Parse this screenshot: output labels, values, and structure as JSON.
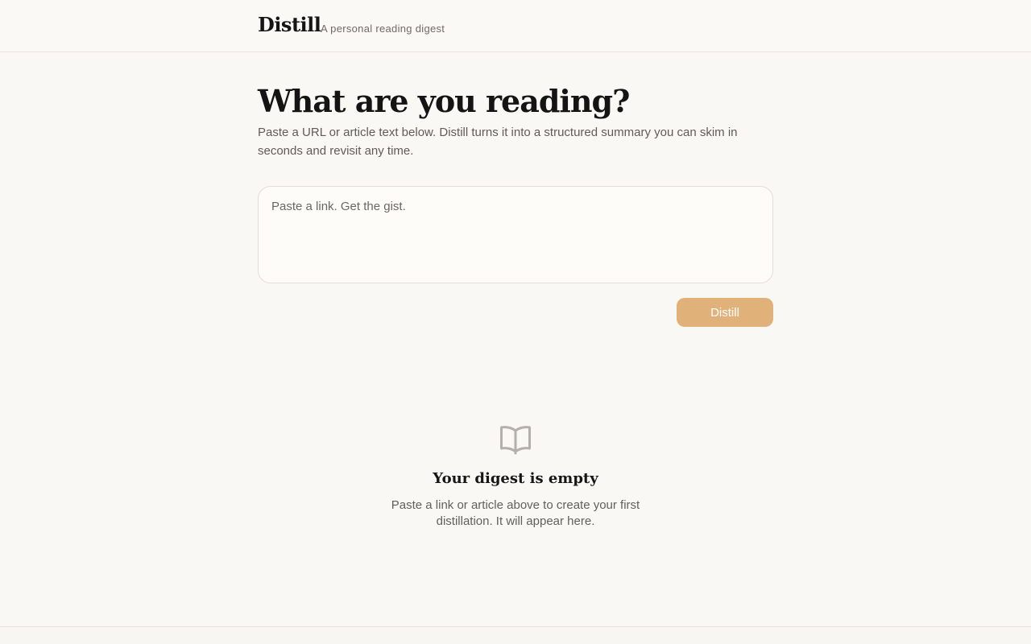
{
  "header": {
    "brand": "Distill",
    "tagline": "A personal reading digest"
  },
  "main": {
    "headline": "What are you reading?",
    "intro": "Paste a URL or article text below. Distill turns it into a structured summary you can skim in seconds and revisit any time.",
    "input": {
      "placeholder": "Paste a link. Get the gist.",
      "value": ""
    },
    "submit_label": "Distill"
  },
  "empty_state": {
    "icon": "open-book-icon",
    "title": "Your digest is empty",
    "description": "Paste a link or article above to create your first distillation. It will appear here."
  },
  "colors": {
    "background": "#faf8f4",
    "accent": "#e1b17a",
    "border": "#e2ded7"
  }
}
